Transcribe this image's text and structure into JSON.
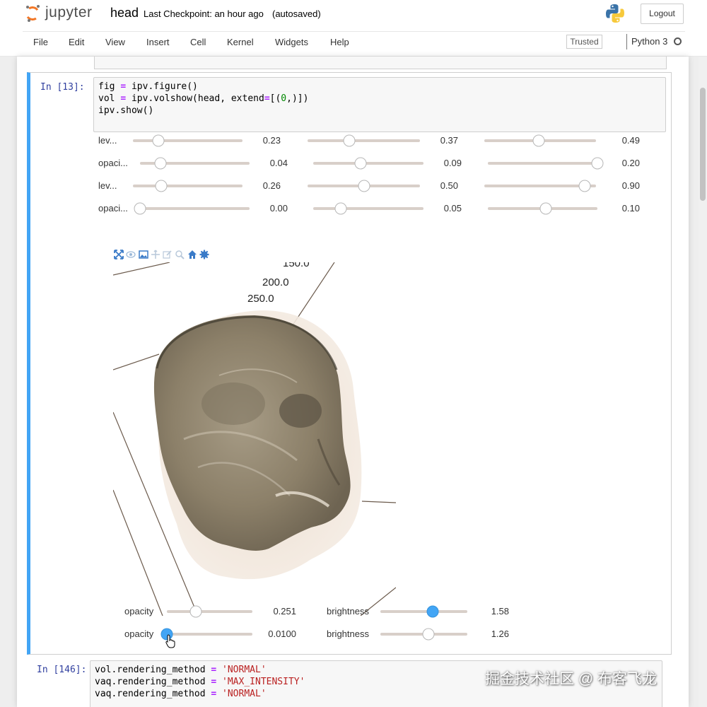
{
  "header": {
    "logo_text": "jupyter",
    "notebook_name": "head",
    "checkpoint": "Last Checkpoint: an hour ago",
    "autosave": "(autosaved)",
    "logout_label": "Logout"
  },
  "menubar": {
    "items": [
      "File",
      "Edit",
      "View",
      "Insert",
      "Cell",
      "Kernel",
      "Widgets",
      "Help"
    ],
    "trusted_label": "Trusted",
    "kernel_name": "Python 3"
  },
  "cell_13": {
    "prompt": "In [13]:",
    "code": {
      "line1": {
        "a": "fig ",
        "op": "=",
        "b": " ipv.figure()"
      },
      "line2": {
        "a": "vol ",
        "op": "=",
        "b": " ipv.volshow(head, extend",
        "op2": "=",
        "c": "[(",
        "n": "0",
        "d": ",)])"
      },
      "line3": {
        "a": "ipv.show()"
      }
    },
    "widget_rows": [
      {
        "label": "lev...",
        "sliders": [
          {
            "value": "0.23",
            "level": 0.23
          },
          {
            "value": "0.37",
            "level": 0.37
          },
          {
            "value": "0.49",
            "level": 0.49
          }
        ]
      },
      {
        "label": "opaci...",
        "sliders": [
          {
            "value": "0.04",
            "level": 0.19
          },
          {
            "value": "0.09",
            "level": 0.43
          },
          {
            "value": "0.20",
            "level": 1.0
          }
        ]
      },
      {
        "label": "lev...",
        "sliders": [
          {
            "value": "0.26",
            "level": 0.26
          },
          {
            "value": "0.50",
            "level": 0.5
          },
          {
            "value": "0.90",
            "level": 0.9
          }
        ]
      },
      {
        "label": "opaci...",
        "sliders": [
          {
            "value": "0.00",
            "level": 0.0
          },
          {
            "value": "0.05",
            "level": 0.25
          },
          {
            "value": "0.10",
            "level": 0.53
          }
        ]
      }
    ],
    "toolbar_icons": [
      "fullscreen-icon",
      "eye-icon",
      "image-icon",
      "arrows-icon",
      "edit-icon",
      "zoom-icon",
      "home-icon",
      "gear-icon"
    ],
    "axis_ticks": [
      "150.0",
      "200.0",
      "250.0"
    ],
    "bottom_controls": [
      {
        "label": "opacity",
        "value": "0.251",
        "level": 0.34,
        "active": false,
        "label2": "brightness",
        "value2": "1.58",
        "level2": 0.6,
        "active2": true
      },
      {
        "label": "opacity",
        "value": "0.0100",
        "level": 0.0,
        "active": true,
        "label2": "brightness",
        "value2": "1.26",
        "level2": 0.55,
        "active2": false
      }
    ]
  },
  "cell_146": {
    "prompt": "In [146]:",
    "lines": [
      {
        "a": "vol.rendering_method ",
        "op": "=",
        "s": " 'NORMAL'"
      },
      {
        "a": "vaq.rendering_method ",
        "op": "=",
        "s": " 'MAX_INTENSITY'"
      },
      {
        "a": "vaq.rendering_method ",
        "op": "=",
        "s": " 'NORMAL'"
      }
    ]
  },
  "watermark": "掘金技术社区 @ 布客飞龙",
  "colors": {
    "accent": "#42a5f5",
    "prompt": "#303f9f",
    "jupyter_orange": "#f37726"
  }
}
